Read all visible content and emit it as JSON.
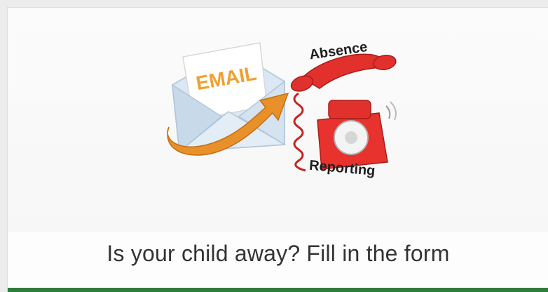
{
  "card": {
    "caption": "Is your child away? Fill in the form",
    "accent_color": "#2f7d3a"
  },
  "illustration": {
    "email_label": "EMAIL",
    "absence_label": "Absence",
    "reporting_label": "Reporting",
    "icons": [
      "envelope-icon",
      "arrow-icon",
      "telephone-icon"
    ]
  }
}
